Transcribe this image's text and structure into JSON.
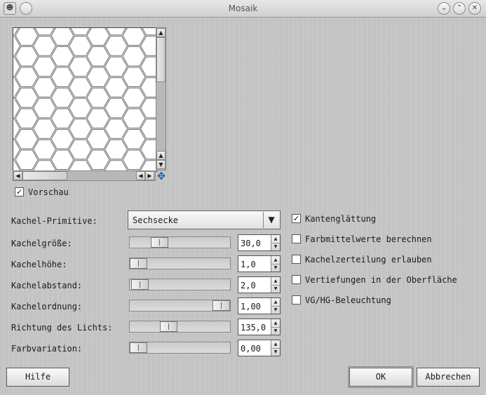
{
  "window": {
    "title": "Mosaik"
  },
  "preview": {
    "toggle": {
      "label": "Vorschau",
      "checked": true
    },
    "vscroll_up": "▲",
    "vscroll_down": "▼",
    "vscroll_up2": "▲",
    "hscroll_left": "◀",
    "hscroll_right": "▶",
    "hscroll_left2": "◀"
  },
  "params": {
    "primitive": {
      "label": "Kachel-Primitive:",
      "value": "Sechsecke"
    },
    "sliders": [
      {
        "label": "Kachelgröße:",
        "value": "30,0"
      },
      {
        "label": "Kachelhöhe:",
        "value": "1,0"
      },
      {
        "label": "Kachelabstand:",
        "value": "2,0"
      },
      {
        "label": "Kachelordnung:",
        "value": "1,00"
      },
      {
        "label": "Richtung des Lichts:",
        "value": "135,0"
      },
      {
        "label": "Farbvariation:",
        "value": "0,00"
      }
    ]
  },
  "options": [
    {
      "label": "Kantenglättung",
      "checked": true
    },
    {
      "label": "Farbmittelwerte berechnen",
      "checked": false
    },
    {
      "label": "Kachelzerteilung erlauben",
      "checked": false
    },
    {
      "label": "Vertiefungen in der Oberfläche",
      "checked": false
    },
    {
      "label": "VG/HG-Beleuchtung",
      "checked": false
    }
  ],
  "buttons": {
    "help": "Hilfe",
    "ok": "OK",
    "cancel": "Abbrechen"
  }
}
